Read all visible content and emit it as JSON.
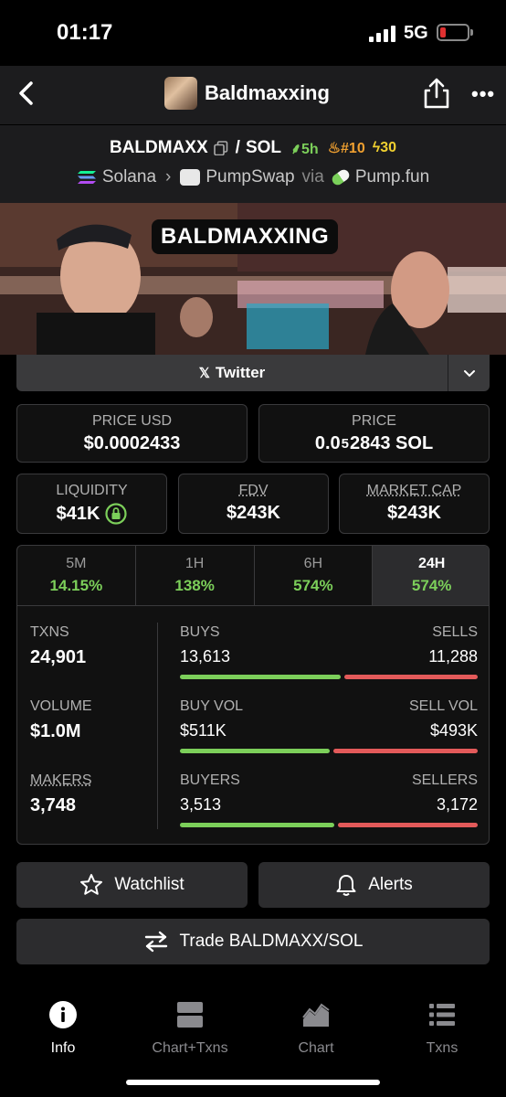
{
  "status_bar": {
    "time": "01:17",
    "network": "5G"
  },
  "nav": {
    "title": "Baldmaxxing"
  },
  "pair": {
    "base": "BALDMAXX",
    "separator": "/",
    "quote": "SOL",
    "age": "5h",
    "rank": "#10",
    "boosts": "30"
  },
  "chain": {
    "chain": "Solana",
    "dex": "PumpSwap",
    "via_label": "via",
    "launchpad": "Pump.fun"
  },
  "banner": {
    "title": "BALDMAXXING"
  },
  "social": {
    "twitter_label": "Twitter"
  },
  "price_usd": {
    "label": "PRICE USD",
    "value": "$0.0002433"
  },
  "price": {
    "label": "PRICE",
    "prefix": "0.0",
    "zeros": "5",
    "digits": "2843",
    "unit": "SOL"
  },
  "liquidity": {
    "label": "LIQUIDITY",
    "value": "$41K"
  },
  "fdv": {
    "label": "FDV",
    "value": "$243K"
  },
  "market_cap": {
    "label": "MARKET CAP",
    "value": "$243K"
  },
  "timeframes": [
    {
      "label": "5M",
      "change": "14.15%"
    },
    {
      "label": "1H",
      "change": "138%"
    },
    {
      "label": "6H",
      "change": "574%"
    },
    {
      "label": "24H",
      "change": "574%"
    }
  ],
  "stats": {
    "txns": {
      "label": "TXNS",
      "value": "24,901"
    },
    "volume": {
      "label": "VOLUME",
      "value": "$1.0M"
    },
    "makers": {
      "label": "MAKERS",
      "value": "3,748"
    },
    "buys": {
      "label": "BUYS",
      "value": "13,613",
      "ratio": 0.547
    },
    "sells": {
      "label": "SELLS",
      "value": "11,288"
    },
    "buy_vol": {
      "label": "BUY VOL",
      "value": "$511K",
      "ratio": 0.509
    },
    "sell_vol": {
      "label": "SELL VOL",
      "value": "$493K"
    },
    "buyers": {
      "label": "BUYERS",
      "value": "3,513",
      "ratio": 0.525
    },
    "sellers": {
      "label": "SELLERS",
      "value": "3,172"
    }
  },
  "actions": {
    "watchlist": "Watchlist",
    "alerts": "Alerts",
    "trade": "Trade BALDMAXX/SOL"
  },
  "tab_bar": [
    {
      "label": "Info",
      "icon": "info-icon"
    },
    {
      "label": "Chart+Txns",
      "icon": "chart-txns-icon"
    },
    {
      "label": "Chart",
      "icon": "chart-icon"
    },
    {
      "label": "Txns",
      "icon": "list-icon"
    }
  ],
  "colors": {
    "positive": "#7ccf5a",
    "negative": "#e35a5a",
    "rank": "#f0a030",
    "boost": "#f0d030"
  }
}
